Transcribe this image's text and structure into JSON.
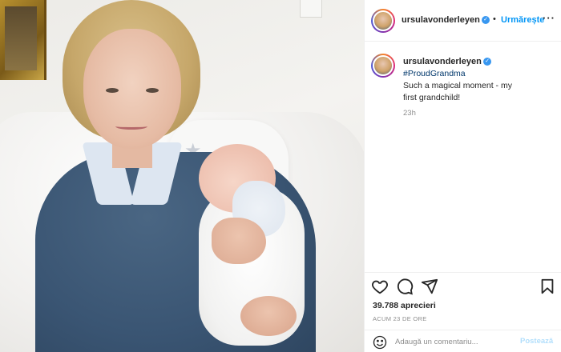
{
  "post": {
    "username": "ursulavonderleyen",
    "verified_mark": "✓",
    "follow_label": "Urmărește",
    "separator": "•",
    "more_label": "···"
  },
  "caption": {
    "username": "ursulavonderleyen",
    "hashtag": "#ProudGrandma",
    "text": "Such a magical moment - my first grandchild!",
    "time": "23h"
  },
  "actions": {
    "icons": [
      "heart-icon",
      "comment-icon",
      "share-icon",
      "bookmark-icon"
    ],
    "likes": "39.788 aprecieri",
    "timestamp": "ACUM 23 DE ORE"
  },
  "comment": {
    "placeholder": "Adaugă un comentariu...",
    "post_label": "Postează"
  },
  "colors": {
    "accent": "#0095f6",
    "verified": "#3897f0",
    "hashtag": "#00376b",
    "muted": "#8e8e8e",
    "post_disabled": "#b2dffc"
  }
}
